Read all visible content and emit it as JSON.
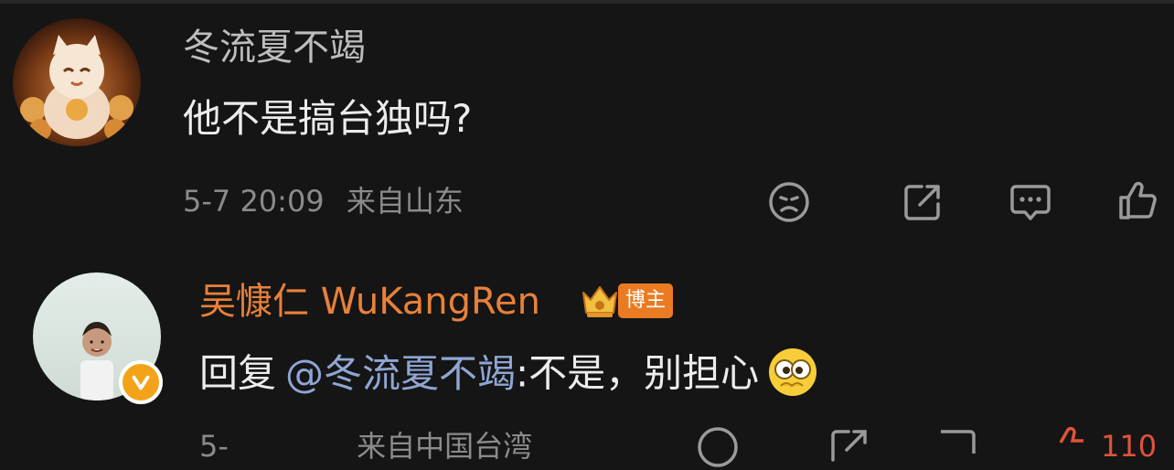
{
  "comments": [
    {
      "username": "冬流夏不竭",
      "text": "他不是搞台独吗?",
      "time": "5-7 20:09",
      "location": "来自山东",
      "icons": [
        "sad-face-icon",
        "share-icon",
        "comment-icon",
        "like-icon"
      ]
    },
    {
      "username": "吴慷仁 WuKangRen",
      "badge": "博主",
      "reply_prefix": "回复",
      "mention": "@冬流夏不竭",
      "text": ":不是，别担心",
      "time": "5-",
      "location": "来自中国台湾",
      "like_count": "110",
      "icons": [
        "sad-face-icon",
        "share-icon",
        "comment-icon",
        "like-icon"
      ]
    }
  ],
  "colors": {
    "background": "#151515",
    "username_gray": "#bdbdbd",
    "vip_orange": "#e8813a",
    "mention_blue": "#8fa6d4",
    "meta_gray": "#8b8b8b",
    "like_red": "#e0533a"
  }
}
